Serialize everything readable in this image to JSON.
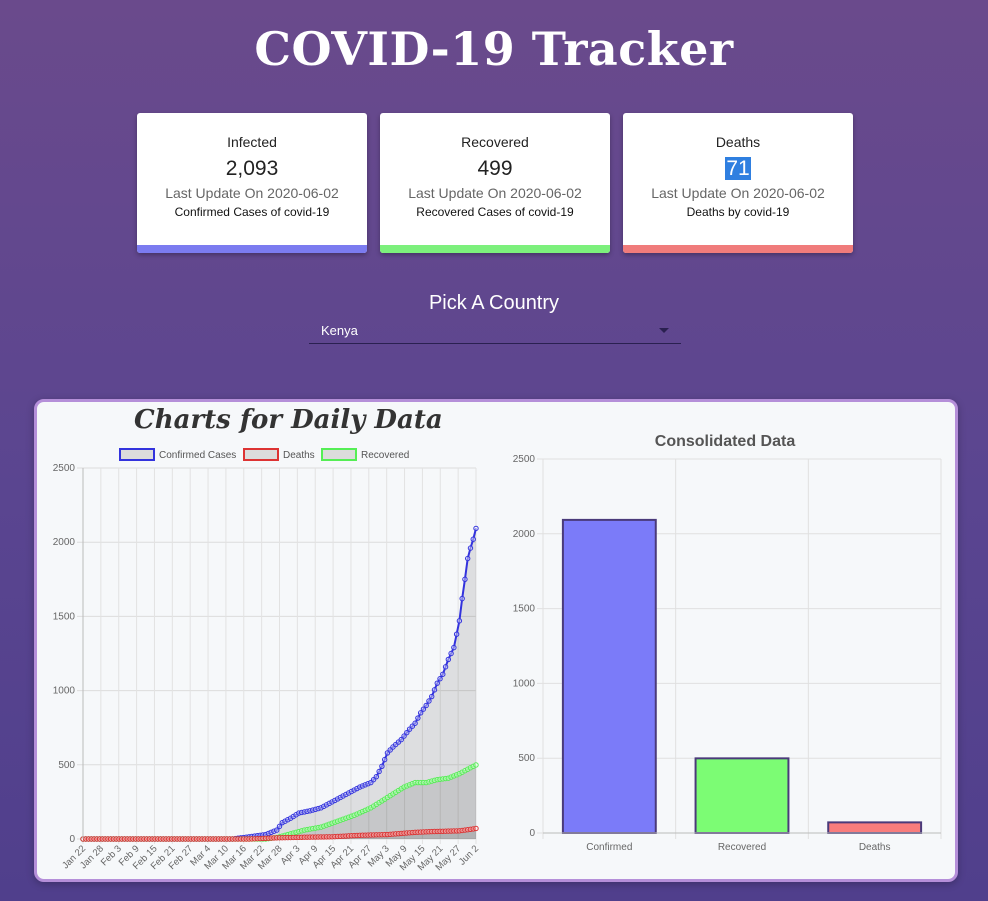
{
  "app": {
    "title": "COVID-19 Tracker"
  },
  "cards": [
    {
      "label": "Infected",
      "value": "2,093",
      "update": "Last Update On 2020-06-02",
      "desc": "Confirmed Cases of covid-19",
      "color": "#7b7bf0"
    },
    {
      "label": "Recovered",
      "value": "499",
      "update": "Last Update On 2020-06-02",
      "desc": "Recovered Cases of covid-19",
      "color": "#7cf07c"
    },
    {
      "label": "Deaths",
      "value": "71",
      "update": "Last Update On 2020-06-02",
      "desc": "Deaths by covid-19",
      "color": "#f07b7b"
    }
  ],
  "picker": {
    "title": "Pick A Country",
    "selected": "Kenya"
  },
  "panel": {
    "title": "Charts for Daily Data"
  },
  "chart_data": [
    {
      "type": "line",
      "legend": [
        "Confirmed Cases",
        "Deaths",
        "Recovered"
      ],
      "legend_placement": "top",
      "colors": {
        "confirmed": "#3333dd",
        "deaths": "#dd3333",
        "recovered": "#55ee55"
      },
      "ylim": [
        0,
        2500
      ],
      "yticks": [
        0,
        500,
        1000,
        1500,
        2000,
        2500
      ],
      "xticklabels": [
        "Jan 22",
        "Jan 28",
        "Feb 3",
        "Feb 9",
        "Feb 15",
        "Feb 21",
        "Feb 27",
        "Mar 4",
        "Mar 10",
        "Mar 16",
        "Mar 22",
        "Mar 28",
        "Apr 3",
        "Apr 9",
        "Apr 15",
        "Apr 21",
        "Apr 27",
        "May 3",
        "May 9",
        "May 15",
        "May 21",
        "May 27",
        "Jun 2"
      ],
      "grid": true,
      "series": [
        {
          "name": "Confirmed Cases",
          "points": [
            [
              0,
              0
            ],
            [
              54,
              0
            ],
            [
              60,
              15
            ],
            [
              66,
              30
            ],
            [
              70,
              60
            ],
            [
              72,
              110
            ],
            [
              75,
              140
            ],
            [
              78,
              175
            ],
            [
              82,
              190
            ],
            [
              86,
              210
            ],
            [
              90,
              250
            ],
            [
              94,
              290
            ],
            [
              98,
              330
            ],
            [
              100,
              350
            ],
            [
              104,
              380
            ],
            [
              106,
              420
            ],
            [
              108,
              490
            ],
            [
              110,
              580
            ],
            [
              112,
              620
            ],
            [
              115,
              670
            ],
            [
              118,
              740
            ],
            [
              120,
              780
            ],
            [
              122,
              850
            ],
            [
              124,
              900
            ],
            [
              126,
              960
            ],
            [
              128,
              1050
            ],
            [
              130,
              1110
            ],
            [
              132,
              1210
            ],
            [
              134,
              1290
            ],
            [
              136,
              1470
            ],
            [
              137,
              1620
            ],
            [
              138,
              1750
            ],
            [
              139,
              1890
            ],
            [
              140,
              1960
            ],
            [
              141,
              2020
            ],
            [
              142,
              2093
            ]
          ]
        },
        {
          "name": "Deaths",
          "points": [
            [
              0,
              0
            ],
            [
              60,
              0
            ],
            [
              70,
              8
            ],
            [
              80,
              12
            ],
            [
              90,
              15
            ],
            [
              100,
              25
            ],
            [
              110,
              30
            ],
            [
              120,
              45
            ],
            [
              126,
              50
            ],
            [
              130,
              52
            ],
            [
              136,
              55
            ],
            [
              140,
              65
            ],
            [
              142,
              71
            ]
          ]
        },
        {
          "name": "Recovered",
          "points": [
            [
              0,
              0
            ],
            [
              66,
              0
            ],
            [
              70,
              10
            ],
            [
              76,
              40
            ],
            [
              80,
              60
            ],
            [
              86,
              80
            ],
            [
              92,
              120
            ],
            [
              98,
              160
            ],
            [
              104,
              210
            ],
            [
              110,
              280
            ],
            [
              116,
              350
            ],
            [
              120,
              380
            ],
            [
              124,
              380
            ],
            [
              128,
              400
            ],
            [
              132,
              410
            ],
            [
              136,
              440
            ],
            [
              140,
              480
            ],
            [
              142,
              499
            ]
          ]
        }
      ]
    },
    {
      "type": "bar",
      "title": "Consolidated Data",
      "categories": [
        "Confirmed",
        "Recovered",
        "Deaths"
      ],
      "values": [
        2093,
        499,
        71
      ],
      "colors": [
        "#7b7bf9",
        "#7cfc74",
        "#f87c7c"
      ],
      "ylim": [
        0,
        2500
      ],
      "yticks": [
        0,
        500,
        1000,
        1500,
        2000,
        2500
      ],
      "grid": true
    }
  ]
}
